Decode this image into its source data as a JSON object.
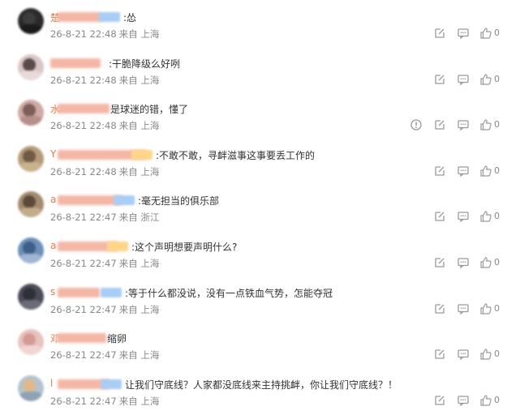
{
  "colors": {
    "meta_text": "#888888",
    "body_text": "#333333",
    "name_blur_orange": "#f4b7a6",
    "badge_blue": "#a9cdf5",
    "badge_yellow": "#ffd68a",
    "icon": "#9a9a9a"
  },
  "comments": [
    {
      "initial": "楚",
      "text": ":怂",
      "date": "26-8-21 22:48",
      "source": "来自 上海",
      "likes": "0",
      "report": false,
      "badge": "blue"
    },
    {
      "initial": "",
      "text": ":干脆降级么好咧",
      "date": "26-8-21 22:48",
      "source": "来自 上海",
      "likes": "0",
      "report": false,
      "badge": "none"
    },
    {
      "initial": "水",
      "text": "是球迷的错，懂了",
      "date": "26-8-21 22:48",
      "source": "来自 上海",
      "likes": "0",
      "report": true,
      "badge": "none"
    },
    {
      "initial": "Y",
      "text": ":不敢不敢，寻衅滋事这事要丢工作的",
      "date": "26-8-21 22:48",
      "source": "来自 上海",
      "likes": "0",
      "report": false,
      "badge": "yellow"
    },
    {
      "initial": "a",
      "text": ":毫无担当的俱乐部",
      "date": "26-8-21 22:47",
      "source": "来自 浙江",
      "likes": "0",
      "report": false,
      "badge": "blue"
    },
    {
      "initial": "a",
      "text": ":这个声明想要声明什么?",
      "date": "26-8-21 22:47",
      "source": "来自 上海",
      "likes": "0",
      "report": false,
      "badge": "yellow"
    },
    {
      "initial": "s",
      "text": ":等于什么都没说，没有一点铁血气势，怎能夺冠",
      "date": "26-8-21 22:47",
      "source": "来自 上海",
      "likes": "0",
      "report": false,
      "badge": "blue"
    },
    {
      "initial": "邓",
      "text": "缩卵",
      "date": "26-8-21 22:47",
      "source": "来自 上海",
      "likes": "0",
      "report": false,
      "badge": "none"
    },
    {
      "initial": "l",
      "text": "让我们守底线？人家都没底线来主持挑衅，你让我们守底线？！",
      "date": "26-8-21 22:47",
      "source": "来自 上海",
      "likes": "0",
      "report": false,
      "badge": "blue"
    }
  ]
}
